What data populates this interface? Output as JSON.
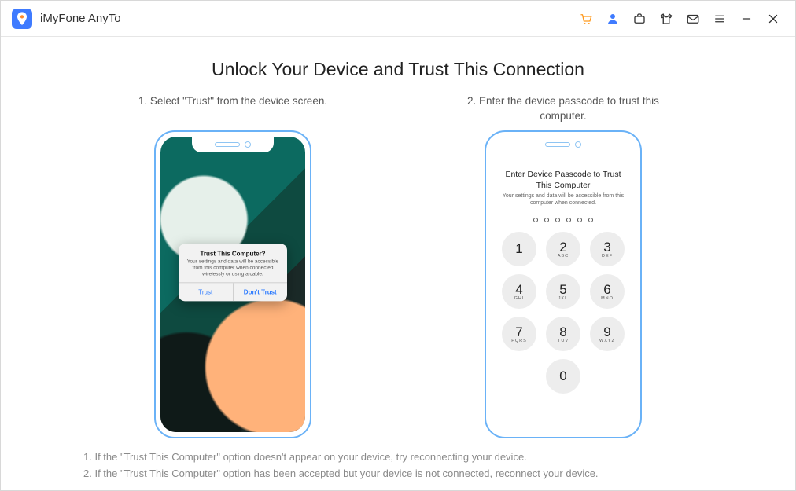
{
  "header": {
    "title": "iMyFone AnyTo"
  },
  "main": {
    "heading": "Unlock Your Device and Trust This Connection",
    "step1": {
      "text": "1. Select \"Trust\" from the device screen.",
      "dialog": {
        "title": "Trust This Computer?",
        "subtitle": "Your settings and data will be accessible from this computer when connected wirelessly or using a cable.",
        "trust": "Trust",
        "dont_trust": "Don't Trust"
      }
    },
    "step2": {
      "text": "2. Enter the device passcode to trust this computer.",
      "pass_title": "Enter Device Passcode to Trust This Computer",
      "pass_sub": "Your settings and data will be accessible from this computer when connected.",
      "keys": {
        "k1": {
          "n": "1",
          "l": ""
        },
        "k2": {
          "n": "2",
          "l": "ABC"
        },
        "k3": {
          "n": "3",
          "l": "DEF"
        },
        "k4": {
          "n": "4",
          "l": "GHI"
        },
        "k5": {
          "n": "5",
          "l": "JKL"
        },
        "k6": {
          "n": "6",
          "l": "MNO"
        },
        "k7": {
          "n": "7",
          "l": "PQRS"
        },
        "k8": {
          "n": "8",
          "l": "TUV"
        },
        "k9": {
          "n": "9",
          "l": "WXYZ"
        },
        "k0": {
          "n": "0",
          "l": ""
        }
      }
    },
    "notes": {
      "n1": "1. If the \"Trust This Computer\" option doesn't appear on your device, try reconnecting your device.",
      "n2": "2. If the \"Trust This Computer\" option has been accepted but your device is not connected, reconnect your device."
    }
  }
}
